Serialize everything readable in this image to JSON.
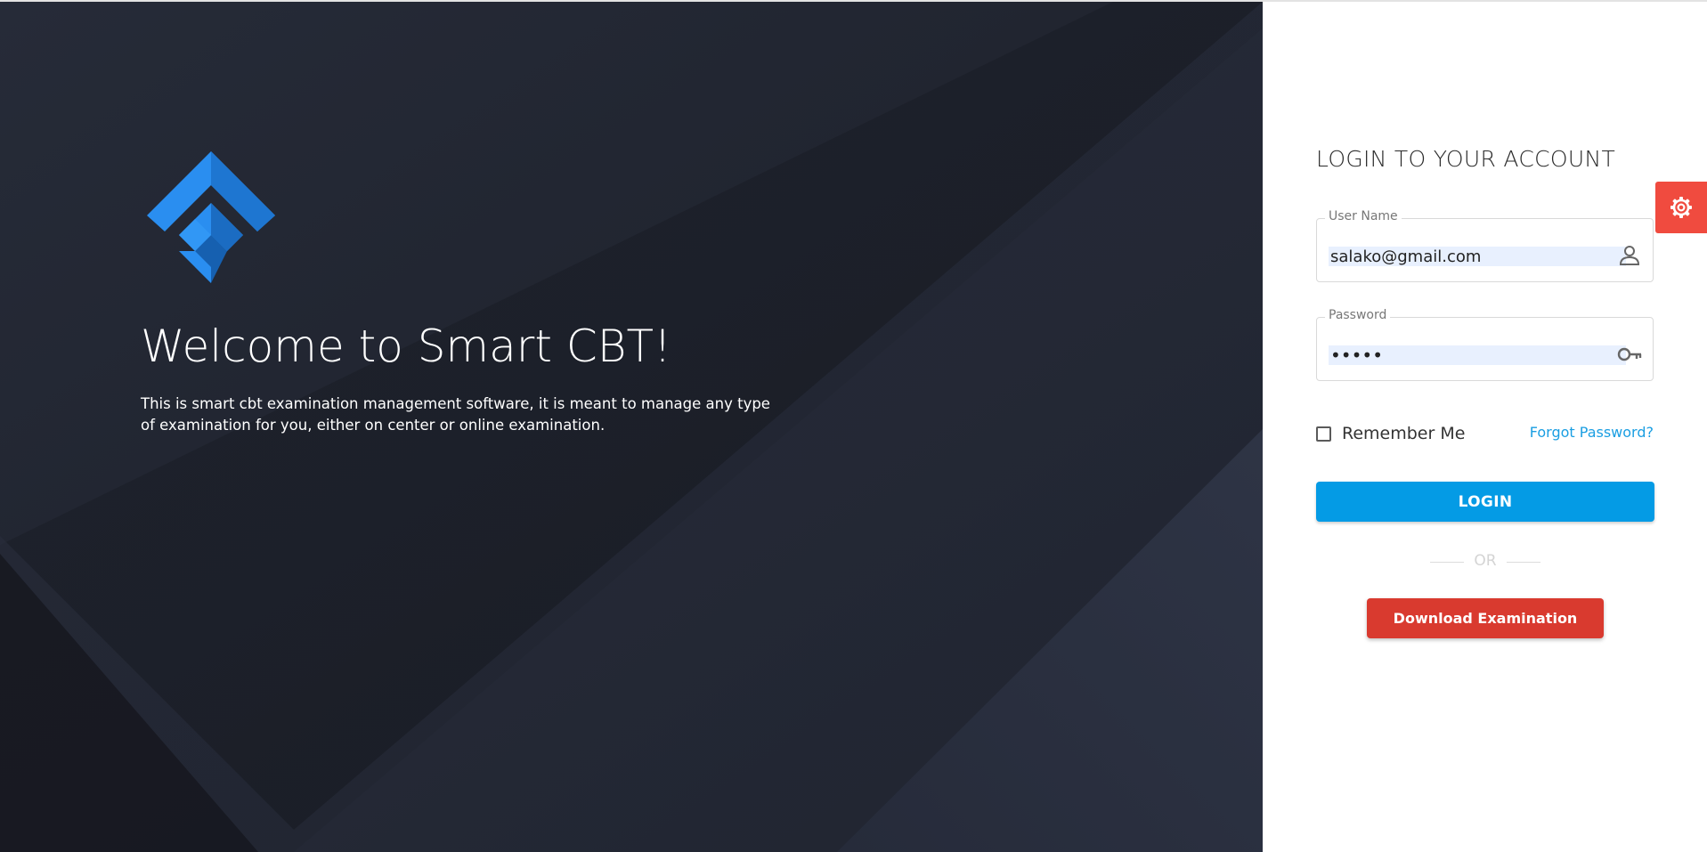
{
  "colors": {
    "hero_background": "#1e222d",
    "accent_blue": "#049be5",
    "link_blue": "#1a9ee2",
    "danger_red": "#d93a2f",
    "settings_red": "#f04b3f",
    "autofill_bg": "#e8f0fe"
  },
  "hero": {
    "logo_icon": "smart-cbt-diamond-logo",
    "title": "Welcome to Smart CBT!",
    "description": "This is smart cbt examination management software, it is meant to manage any type of examination for you, either on center or online examination."
  },
  "login": {
    "title": "LOGIN TO YOUR ACCOUNT",
    "username": {
      "label": "User Name",
      "value": "salako@gmail.com",
      "icon": "person-icon"
    },
    "password": {
      "label": "Password",
      "value": "•••••",
      "icon": "key-icon"
    },
    "remember_label": "Remember Me",
    "remember_checked": false,
    "forgot_label": "Forgot Password?",
    "login_button": "LOGIN",
    "or_text": "OR",
    "download_button": "Download Examination"
  },
  "settings": {
    "icon": "gear-icon"
  }
}
